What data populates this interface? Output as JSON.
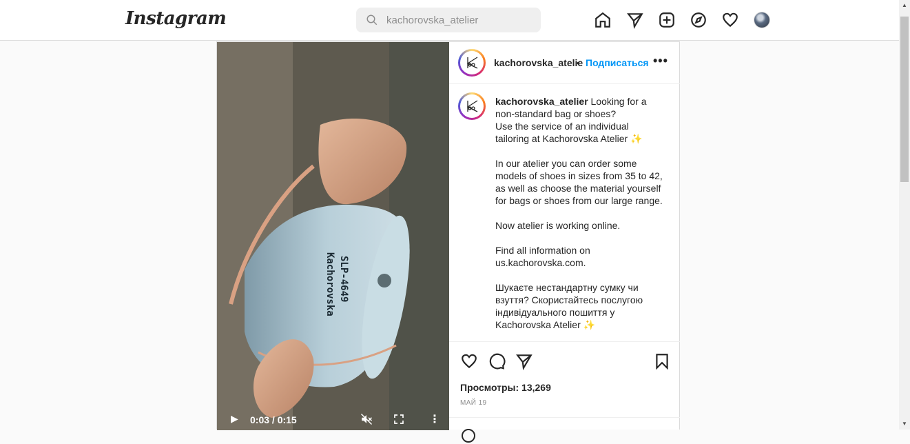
{
  "app": {
    "logo": "Instagram",
    "search": {
      "value": "kachorovska_atelier",
      "placeholder": "Search"
    },
    "nav_icons": [
      "home-icon",
      "direct-icon",
      "new-post-icon",
      "explore-icon",
      "activity-icon",
      "profile-avatar"
    ]
  },
  "post": {
    "header": {
      "username": "kachorovska_atelie",
      "separator": "•",
      "follow_label": "Подписаться",
      "more_label": "•••"
    },
    "video": {
      "time": "0:03 / 0:15",
      "play_icon": "▶",
      "more_icon": "⋮"
    },
    "caption": {
      "username": "kachorovska_atelier",
      "text": " Looking for a non-standard bag or shoes?\nUse the service of an individual tailoring at Kachorovska Atelier ✨\n\nIn our atelier you can order some models of shoes in sizes from 35 to 42, as well as choose the material yourself for bags or shoes from our large range.\n\nNow atelier is working online.\n\nFind all information on us.kachorovska.com.\n\nШукаєте нестандартну сумку чи взуття? Скористайтесь послугою індивідуального пошиття у Kachorovska Atelier ✨"
    },
    "views": "Просмотры: 13,269",
    "date": "МАЙ 19"
  },
  "colors": {
    "accent": "#0095f6",
    "text": "#262626",
    "muted": "#8e8e8e",
    "border": "#dbdbdb"
  }
}
